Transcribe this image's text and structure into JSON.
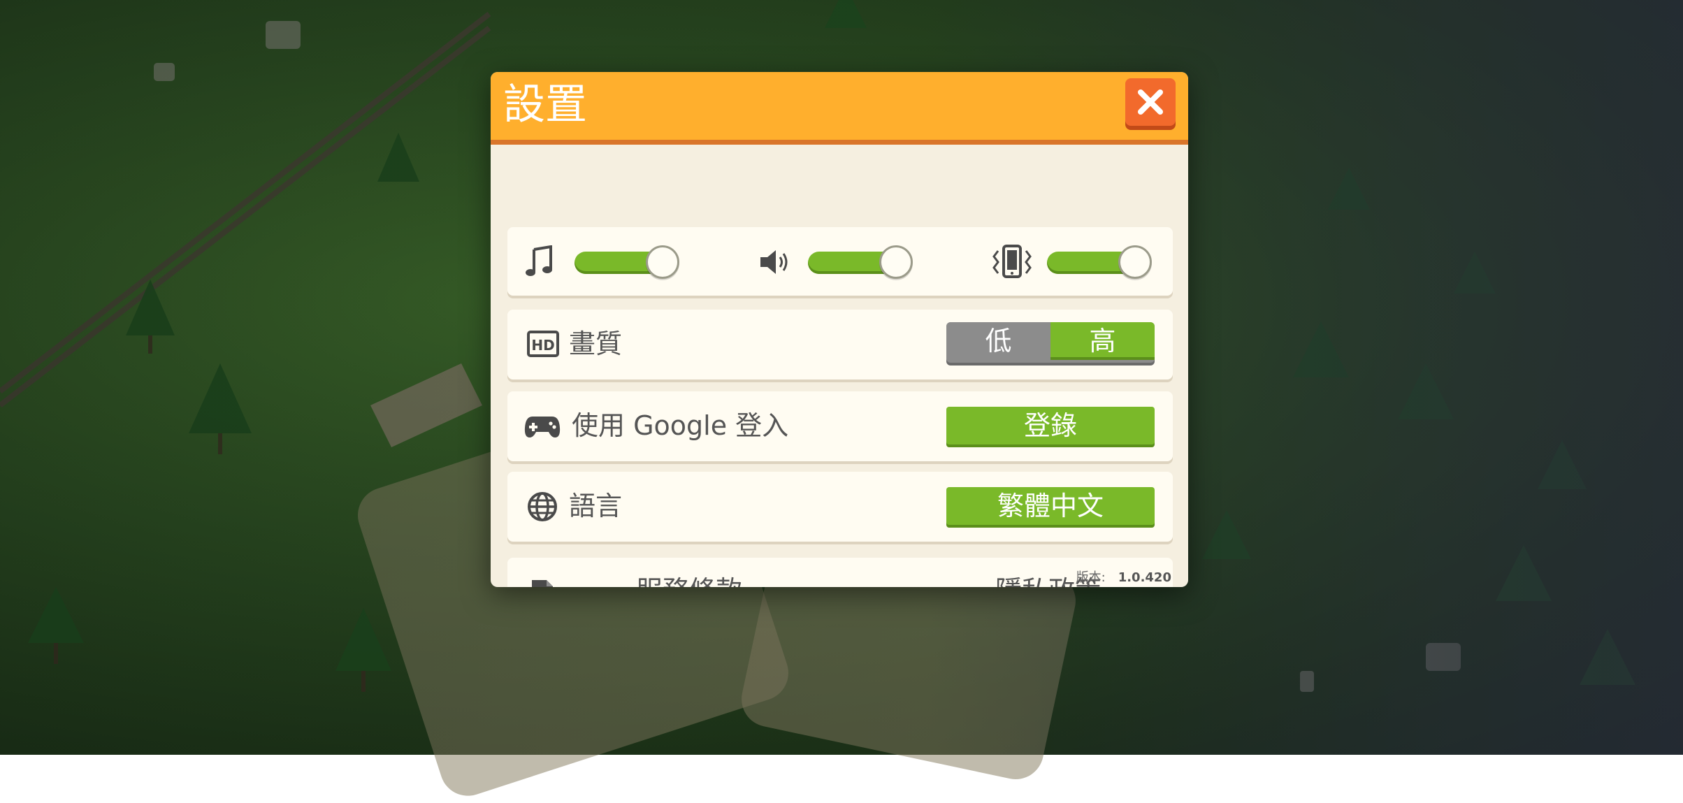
{
  "dialog": {
    "title": "設置"
  },
  "audio": {
    "music_level": 1.0,
    "sound_level": 1.0,
    "vibration_level": 1.0
  },
  "quality": {
    "label": "畫質",
    "low_label": "低",
    "high_label": "高",
    "selected": "high"
  },
  "google": {
    "label": "使用 Google 登入",
    "button_label": "登錄"
  },
  "language": {
    "label": "語言",
    "button_label": "繁體中文"
  },
  "legal": {
    "terms_label": "服務條款",
    "privacy_label": "隱私政策"
  },
  "version": {
    "label": "版本:",
    "value": "1.0.420"
  },
  "colors": {
    "header": "#ffaf2d",
    "close": "#f26a2c",
    "accent_green": "#7ab929",
    "panel": "#f5efe0",
    "card": "#fffcf2"
  },
  "icons": {
    "close": "close-x-icon",
    "music": "music-note-icon",
    "sound": "speaker-icon",
    "vibration": "phone-vibrate-icon",
    "quality": "hd-icon",
    "google": "gamepad-icon",
    "language": "globe-icon",
    "legal": "document-icon"
  }
}
